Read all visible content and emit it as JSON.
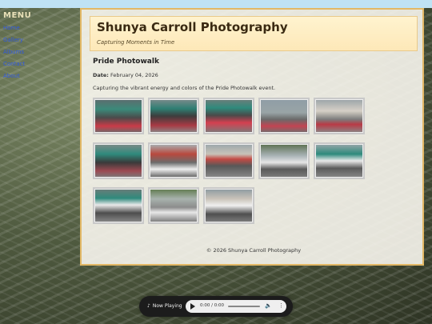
{
  "menu": {
    "title": "MENU",
    "items": [
      "Home",
      "Gallery",
      "Albums",
      "Contact",
      "About"
    ]
  },
  "header": {
    "title": "Shunya Carroll Photography",
    "tagline": "Capturing Moments in Time"
  },
  "album": {
    "title": "Pride Photowalk",
    "date_label": "Date:",
    "date_value": "February 04, 2026",
    "description": "Capturing the vibrant energy and colors of the Pride Photowalk event.",
    "photo_count": 13
  },
  "footer": {
    "copyright": "© 2026 Shunya Carroll Photography"
  },
  "player": {
    "label": "Now Playing",
    "time": "0:00 / 0:00",
    "icons": [
      "music-note-icon",
      "play-icon",
      "volume-icon",
      "more-icon"
    ]
  },
  "colors": {
    "panel_border": "#e2b866",
    "header_bg": "#fde8b8",
    "link": "#2f58e0",
    "top_band": "#bfe2f4"
  }
}
